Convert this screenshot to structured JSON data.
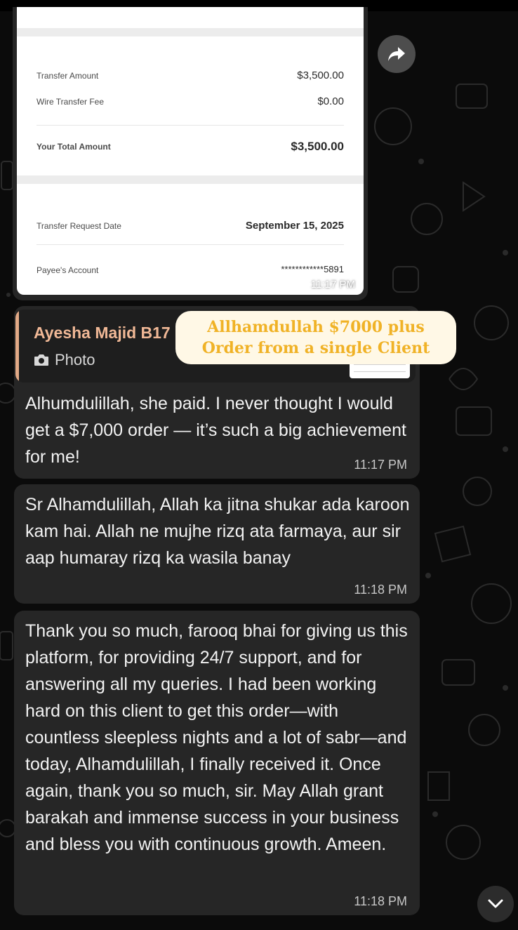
{
  "receipt": {
    "transfer_amount_label": "Transfer Amount",
    "transfer_amount_value": "$3,500.00",
    "fee_label": "Wire Transfer Fee",
    "fee_value": "$0.00",
    "total_label": "Your Total Amount",
    "total_value": "$3,500.00",
    "date_label": "Transfer Request Date",
    "date_value": "September 15, 2025",
    "payee_label": "Payee's Account",
    "payee_value": "************5891",
    "time": "11:17 PM"
  },
  "caption": {
    "line1": "Allhamdullah $7000 plus",
    "line2": "Order from a single Client"
  },
  "reply_quote": {
    "name": "Ayesha Majid B17",
    "type_label": "Photo"
  },
  "messages": [
    {
      "text": "Alhumdulillah, she paid. I never thought I would get a $7,000 order — it’s such a big achievement for me!",
      "time": "11:17 PM"
    },
    {
      "text": "Sr Alhamdulillah, Allah ka jitna shukar ada karoon kam hai. Allah ne mujhe rizq ata farmaya, aur sir aap humaray rizq ka wasila banay",
      "time": "11:18 PM"
    },
    {
      "text": "Thank you so much, farooq bhai for giving us this platform, for providing 24/7 support, and for answering all my queries. I had been working hard on this client to get this order—with countless sleepless nights and a lot of sabr—and today, Alhamdulillah, I finally received it. Once again, thank you so much, sir. May Allah grant barakah and immense success in your business and bless you with continuous growth. Ameen.",
      "time": "11:18 PM"
    }
  ],
  "icons": {
    "forward": "forward-arrow-icon",
    "camera": "camera-icon",
    "scroll": "chevron-down-icon"
  },
  "colors": {
    "background": "#0b0b0b",
    "bubble": "#262626",
    "quote_name": "#f0b896",
    "caption_text": "#f0b226",
    "caption_bg": "#fff8e6"
  }
}
